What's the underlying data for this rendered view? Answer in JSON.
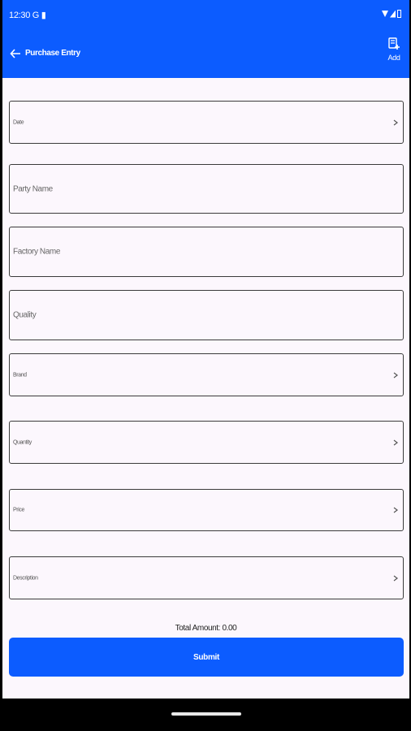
{
  "status_bar": {
    "time": "12:30",
    "left_icons": "G ▮"
  },
  "app_bar": {
    "title": "Purchase Entry",
    "add_label": "Add"
  },
  "form": {
    "date_label": "Date",
    "party_name_placeholder": "Party Name",
    "factory_name_placeholder": "Factory Name",
    "quality_placeholder": "Quality",
    "brand_label": "Brand",
    "quantity_label": "Quantity",
    "price_label": "Price",
    "description_label": "Description",
    "total_amount": "Total Amount: 0.00",
    "submit_label": "Submit"
  },
  "colors": {
    "primary": "#0c5cff",
    "background": "#fcf7fd",
    "border": "#3b3b3b"
  },
  "icons": {
    "back": "arrow-left-icon",
    "add": "add-document-icon",
    "chevron": "chevron-right-icon"
  }
}
